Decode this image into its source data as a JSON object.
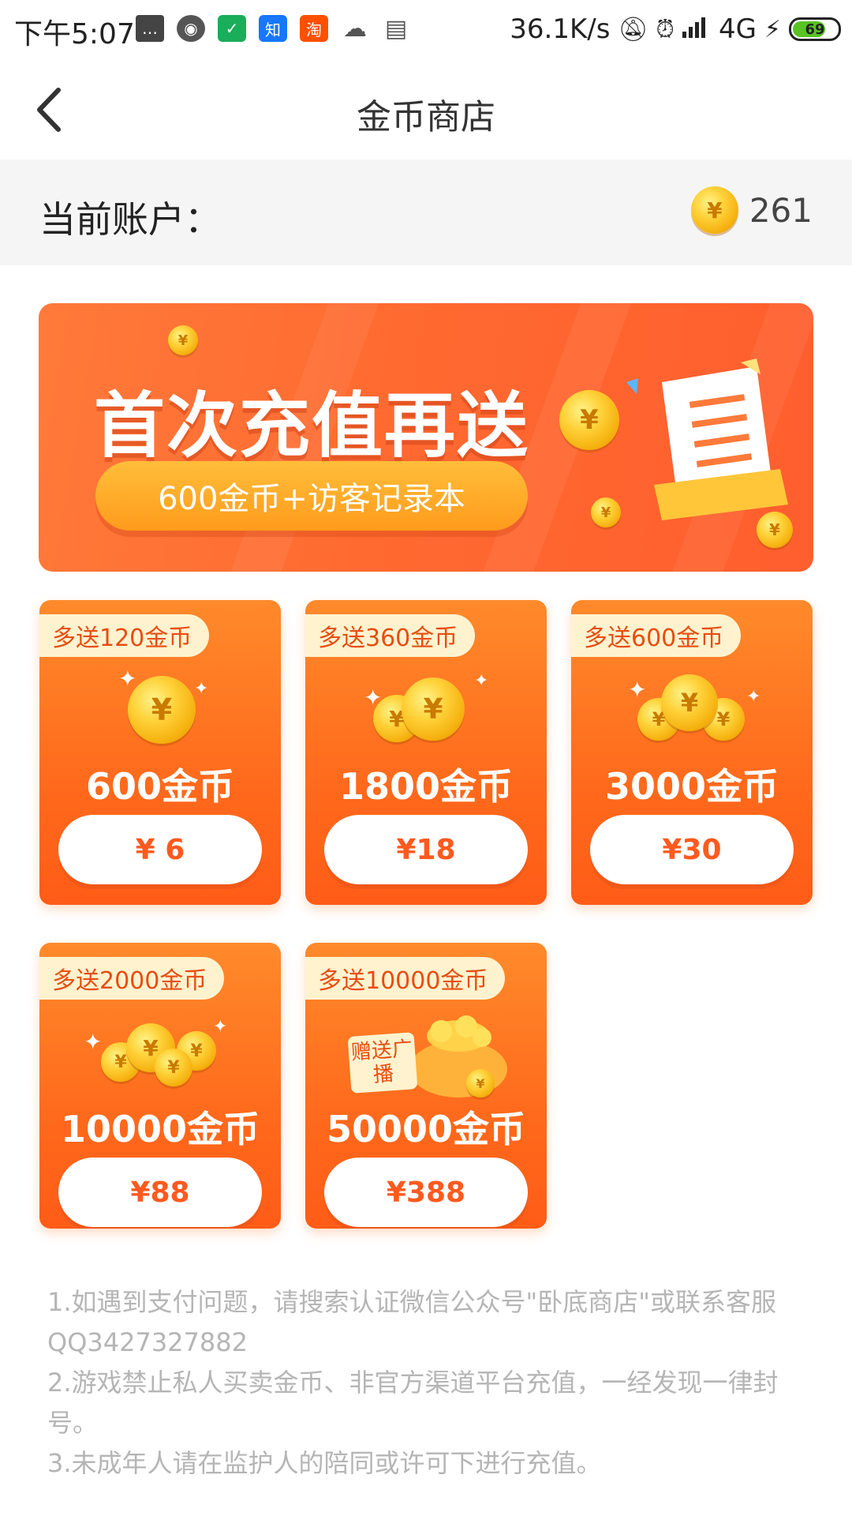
{
  "status_bar": {
    "time": "下午5:07",
    "net_speed": "36.1K/s",
    "network": "4G",
    "battery": "69"
  },
  "nav": {
    "title": "金币商店"
  },
  "account": {
    "label": "当前账户：",
    "balance": "261"
  },
  "banner": {
    "title": "首次充值再送",
    "subtitle": "600金币+访客记录本"
  },
  "products": [
    {
      "bonus": "多送120金币",
      "amount": "600金币",
      "price": "¥ 6"
    },
    {
      "bonus": "多送360金币",
      "amount": "1800金币",
      "price": "¥18"
    },
    {
      "bonus": "多送600金币",
      "amount": "3000金币",
      "price": "¥30"
    },
    {
      "bonus": "多送2000金币",
      "amount": "10000金币",
      "price": "¥88"
    },
    {
      "bonus": "多送10000金币",
      "amount": "50000金币",
      "price": "¥388",
      "gift_label": "赠送广播"
    }
  ],
  "notes": [
    "1.如遇到支付问题，请搜索认证微信公众号\"卧底商店\"或联系客服QQ3427327882",
    "2.游戏禁止私人买卖金币、非官方渠道平台充值，一经发现一律封号。",
    "3.未成年人请在监护人的陪同或许可下进行充值。"
  ],
  "colors": {
    "accent": "#ff6a1c",
    "tag_bg": "#fff3cf",
    "tag_text": "#e84d12",
    "note_text": "#b5b5b5"
  }
}
